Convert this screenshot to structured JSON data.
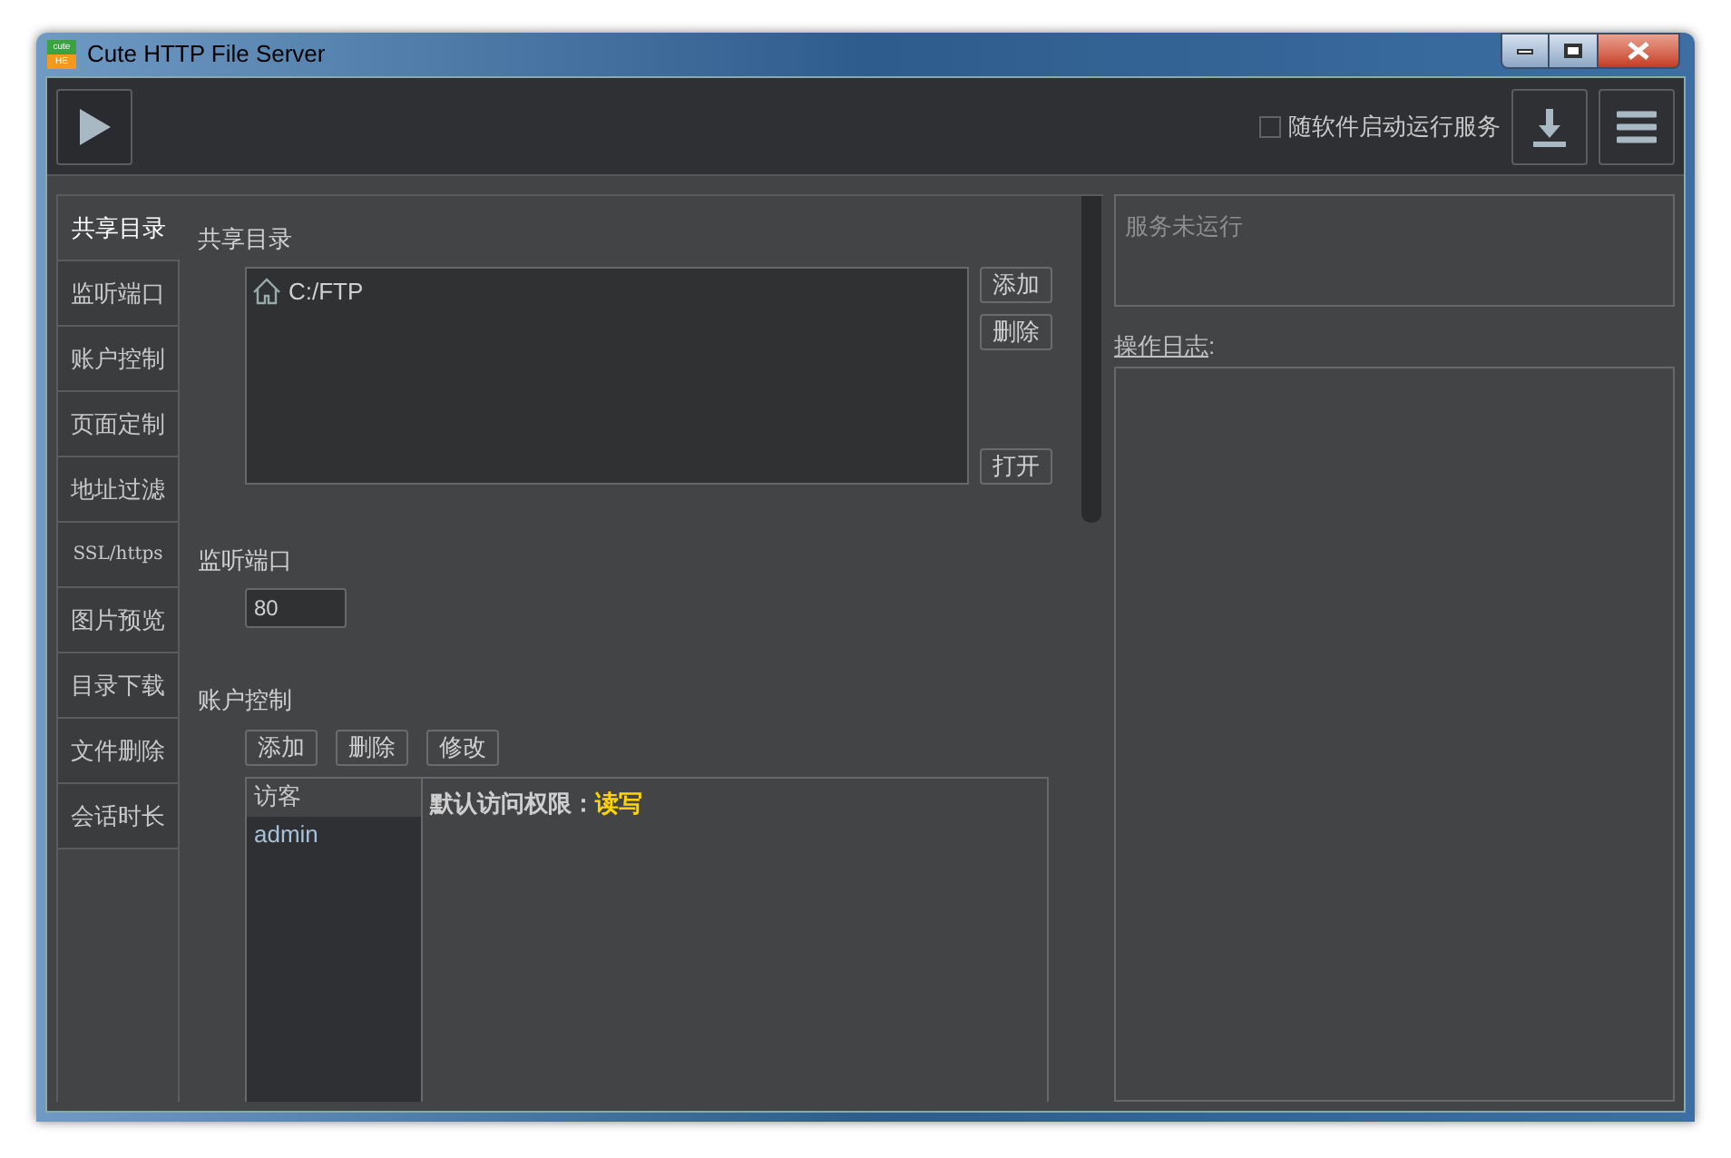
{
  "window": {
    "title": "Cute HTTP File Server",
    "logo_top": "cute",
    "logo_bottom": "HE"
  },
  "toolbar": {
    "autostart": {
      "label": "随软件启动运行服务",
      "checked": false
    }
  },
  "tabs": [
    {
      "label": "共享目录",
      "selected": true
    },
    {
      "label": "监听端口",
      "selected": false
    },
    {
      "label": "账户控制",
      "selected": false
    },
    {
      "label": "页面定制",
      "selected": false
    },
    {
      "label": "地址过滤",
      "selected": false
    },
    {
      "label": "SSL/https",
      "selected": false,
      "kind": "mono"
    },
    {
      "label": "图片预览",
      "selected": false
    },
    {
      "label": "目录下载",
      "selected": false
    },
    {
      "label": "文件删除",
      "selected": false
    },
    {
      "label": "会话时长",
      "selected": false
    }
  ],
  "shared": {
    "heading": "共享目录",
    "folders": [
      "C:/FTP"
    ],
    "buttons": [
      "添加",
      "删除"
    ],
    "open_button": "打开"
  },
  "port": {
    "heading": "监听端口",
    "value": "80"
  },
  "accounts": {
    "heading": "账户控制",
    "buttons": [
      "添加",
      "删除",
      "修改"
    ],
    "users": [
      {
        "name": "访客",
        "selected": true
      },
      {
        "name": "admin",
        "selected": false
      }
    ],
    "permission_label": "默认访问权限：",
    "permission_value": "读写"
  },
  "status": {
    "text": "服务未运行"
  },
  "log": {
    "label": "操作日志",
    "colon": ":"
  }
}
